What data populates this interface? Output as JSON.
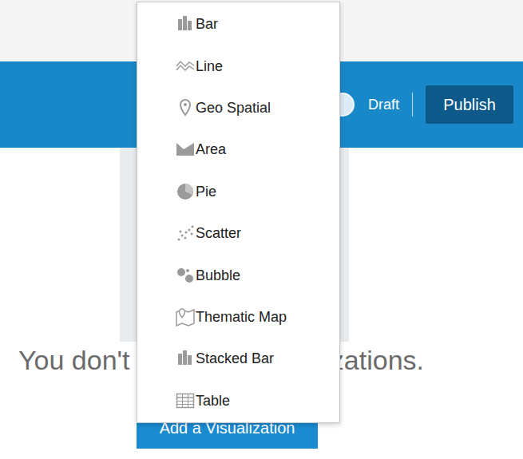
{
  "header": {
    "status": "Draft",
    "publish_button": "Publish"
  },
  "empty_state": {
    "message": "You don't have any visualizations.",
    "add_button": "Add a Visualization"
  },
  "menu": {
    "items": [
      {
        "label": "Bar"
      },
      {
        "label": "Line"
      },
      {
        "label": "Geo Spatial"
      },
      {
        "label": "Area"
      },
      {
        "label": "Pie"
      },
      {
        "label": "Scatter"
      },
      {
        "label": "Bubble"
      },
      {
        "label": "Thematic Map"
      },
      {
        "label": "Stacked Bar"
      },
      {
        "label": "Table"
      }
    ]
  }
}
